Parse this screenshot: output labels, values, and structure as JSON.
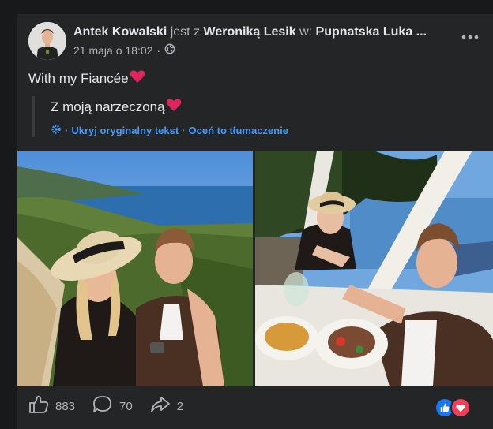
{
  "post": {
    "author": "Antek Kowalski",
    "with_connector": "jest z",
    "tagged_person": "Weroniką Lesik",
    "location_connector": "w:",
    "location": "Pupnatska Luka ...",
    "timestamp": "21 maja o 18:02",
    "separator": "·",
    "privacy_icon": "globe-icon",
    "text": "With my Fiancée"
  },
  "translation": {
    "text": "Z moją narzeczoną",
    "hide_original": "Ukryj oryginalny tekst",
    "separator": "·",
    "rate_translation": "Oceń to tłumaczenie"
  },
  "footer": {
    "likes": "883",
    "comments": "70",
    "shares": "2",
    "reaction_icons": [
      "like-reaction-icon",
      "love-reaction-icon"
    ]
  },
  "colors": {
    "background": "#18191a",
    "card": "#242526",
    "text_primary": "#e4e6eb",
    "text_secondary": "#b0b3b8",
    "link": "#4599ff",
    "like_blue": "#1877f2",
    "love_red": "#f33e58"
  }
}
